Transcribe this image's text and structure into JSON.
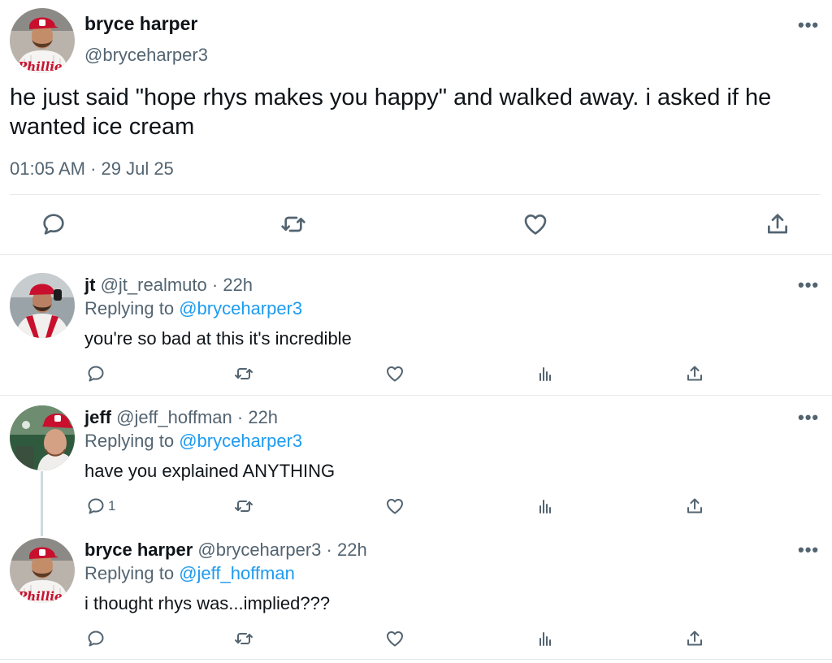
{
  "main_tweet": {
    "author_name": "bryce harper",
    "author_handle": "@bryceharper3",
    "text": "he just said \"hope rhys makes you happy\" and walked away. i asked if he wanted ice cream",
    "timestamp": "01:05 AM · 29 Jul 25",
    "more": "•••"
  },
  "replies": [
    {
      "author_name": "jt",
      "author_handle": "@jt_realmuto",
      "separator": "·",
      "time": "22h",
      "replying_prefix": "Replying to",
      "replying_to": "@bryceharper3",
      "text": "you're so bad at this it's incredible",
      "reply_count": "",
      "more": "•••"
    },
    {
      "author_name": "jeff",
      "author_handle": "@jeff_hoffman",
      "separator": "·",
      "time": "22h",
      "replying_prefix": "Replying to",
      "replying_to": "@bryceharper3",
      "text": "have you explained ANYTHING",
      "reply_count": "1",
      "more": "•••"
    },
    {
      "author_name": "bryce harper",
      "author_handle": "@bryceharper3",
      "separator": "·",
      "time": "22h",
      "replying_prefix": "Replying to",
      "replying_to": "@jeff_hoffman",
      "text": "i thought rhys was...implied???",
      "reply_count": "",
      "more": "•••"
    }
  ],
  "icons": {
    "reply": "reply-icon",
    "retweet": "retweet-icon",
    "like": "heart-icon",
    "views": "analytics-icon",
    "share": "share-icon"
  },
  "colors": {
    "text": "#0f1419",
    "secondary": "#536471",
    "link": "#1d9bf0",
    "divider": "#e6e9ec",
    "phillies_red": "#c8102e"
  }
}
